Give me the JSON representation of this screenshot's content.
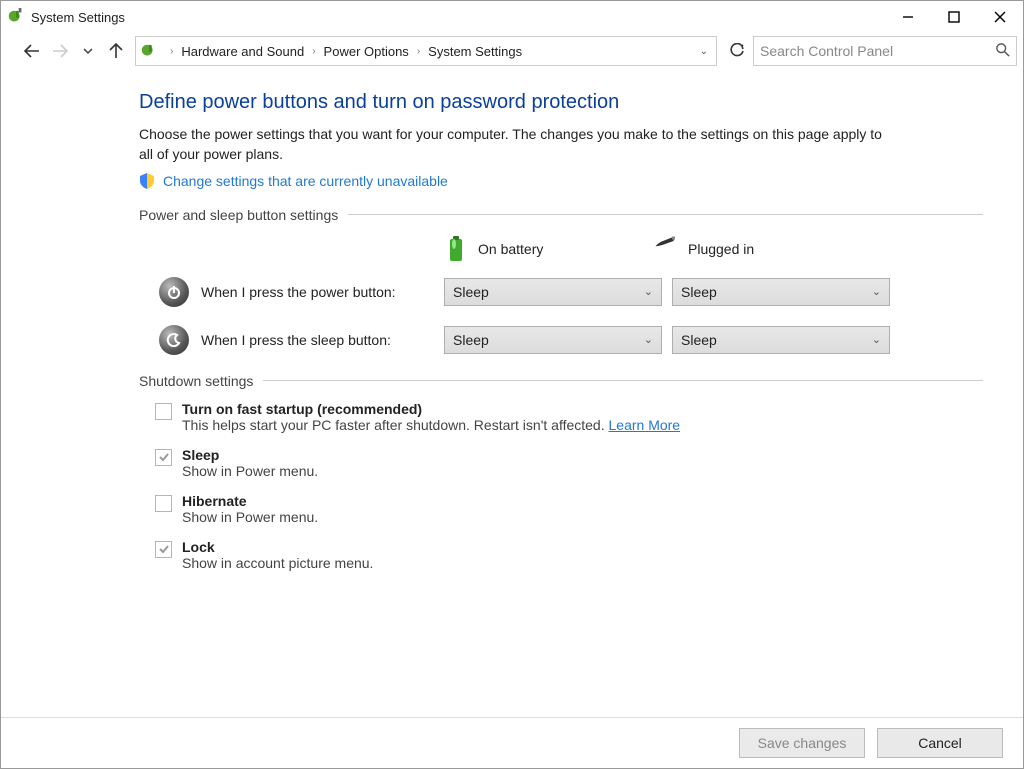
{
  "window": {
    "title": "System Settings"
  },
  "breadcrumbs": {
    "a": "Hardware and Sound",
    "b": "Power Options",
    "c": "System Settings"
  },
  "search": {
    "placeholder": "Search Control Panel"
  },
  "page": {
    "heading": "Define power buttons and turn on password protection",
    "intro": "Choose the power settings that you want for your computer. The changes you make to the settings on this page apply to all of your power plans.",
    "change_link": "Change settings that are currently unavailable"
  },
  "sections": {
    "power": "Power and sleep button settings",
    "shutdown": "Shutdown settings"
  },
  "cols": {
    "battery": "On battery",
    "plugged": "Plugged in"
  },
  "rows": {
    "power_btn": {
      "label": "When I press the power button:",
      "battery": "Sleep",
      "plugged": "Sleep"
    },
    "sleep_btn": {
      "label": "When I press the sleep button:",
      "battery": "Sleep",
      "plugged": "Sleep"
    }
  },
  "shutdown": {
    "fast": {
      "title": "Turn on fast startup (recommended)",
      "desc": "This helps start your PC faster after shutdown. Restart isn't affected. ",
      "learn": "Learn More"
    },
    "sleep": {
      "title": "Sleep",
      "desc": "Show in Power menu."
    },
    "hiber": {
      "title": "Hibernate",
      "desc": "Show in Power menu."
    },
    "lock": {
      "title": "Lock",
      "desc": "Show in account picture menu."
    }
  },
  "buttons": {
    "save": "Save changes",
    "cancel": "Cancel"
  }
}
